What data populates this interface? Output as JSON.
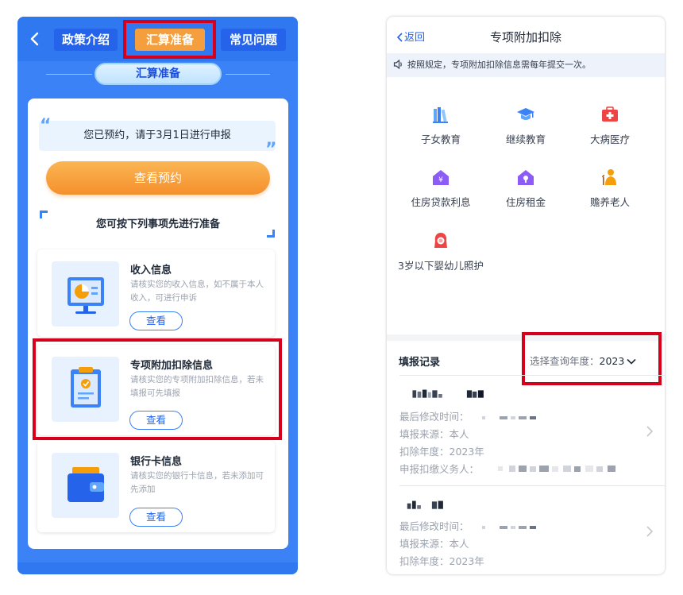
{
  "left": {
    "tabs": [
      "政策介绍",
      "汇算准备",
      "常见问题"
    ],
    "section_title": "汇算准备",
    "notice": "您已预约，请于3月1日进行申报",
    "cta_label": "查看预约",
    "prep_heading": "您可按下列事项先进行准备",
    "items": [
      {
        "title": "收入信息",
        "desc": "请核实您的收入信息，如不属于本人收入，可进行申诉",
        "button": "查看"
      },
      {
        "title": "专项附加扣除信息",
        "desc": "请核实您的专项附加扣除信息，若未填报可先填报",
        "button": "查看"
      },
      {
        "title": "银行卡信息",
        "desc": "请核实您的银行卡信息，若未添加可先添加",
        "button": "查看"
      }
    ]
  },
  "right": {
    "back_label": "返回",
    "title": "专项附加扣除",
    "notice": "按照规定，专项附加扣除信息需每年提交一次。",
    "categories": [
      {
        "label": "子女教育",
        "icon": "books-icon"
      },
      {
        "label": "继续教育",
        "icon": "graduation-cap-icon"
      },
      {
        "label": "大病医疗",
        "icon": "medical-kit-icon"
      },
      {
        "label": "住房贷款利息",
        "icon": "house-yuan-icon"
      },
      {
        "label": "住房租金",
        "icon": "house-key-icon"
      },
      {
        "label": "赡养老人",
        "icon": "elderly-person-icon"
      },
      {
        "label": "3岁以下婴幼儿照护",
        "icon": "baby-care-icon"
      }
    ],
    "records_header": "填报记录",
    "year_select_label": "选择查询年度：",
    "year_value": "2023",
    "records": [
      {
        "modified_label": "最后修改时间：",
        "source": "填报来源：本人",
        "year": "扣除年度：2023年",
        "withholder_label": "申报扣缴义务人："
      },
      {
        "modified_label": "最后修改时间：",
        "source": "填报来源：本人",
        "year": "扣除年度：2023年"
      }
    ]
  },
  "colors": {
    "left_bg": "#3b82f6",
    "active_tab": "#f59e3d",
    "accent_blue": "#2563eb",
    "highlight_red": "#d6001c",
    "cta_orange": "#f58f2c"
  }
}
